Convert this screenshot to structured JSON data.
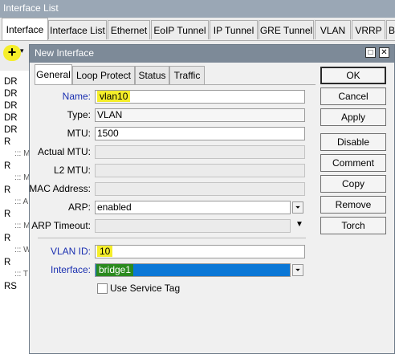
{
  "window": {
    "title": "Interface List"
  },
  "tabs": [
    {
      "label": "Interface",
      "active": true
    },
    {
      "label": "Interface List"
    },
    {
      "label": "Ethernet"
    },
    {
      "label": "EoIP Tunnel"
    },
    {
      "label": "IP Tunnel"
    },
    {
      "label": "GRE Tunnel"
    },
    {
      "label": "VLAN"
    },
    {
      "label": "VRRP"
    },
    {
      "label": "B"
    }
  ],
  "toolbar": {
    "add_icon": "plus-icon",
    "add_glyph": "+",
    "caret": "▾"
  },
  "list_rows": [
    "DR",
    "DR",
    "DR",
    "DR",
    "DR",
    "R",
    "::: M",
    "R",
    "::: M",
    "R",
    "::: A",
    "R",
    "::: M",
    "R",
    "::: W",
    "R",
    "::: T",
    "RS"
  ],
  "dialog": {
    "title": "New Interface",
    "tabs": [
      "General",
      "Loop Protect",
      "Status",
      "Traffic"
    ],
    "fields": {
      "name": {
        "label": "Name:",
        "value": "vlan10"
      },
      "type": {
        "label": "Type:",
        "value": "VLAN"
      },
      "mtu": {
        "label": "MTU:",
        "value": "1500"
      },
      "actual_mtu": {
        "label": "Actual MTU:",
        "value": ""
      },
      "l2_mtu": {
        "label": "L2 MTU:",
        "value": ""
      },
      "mac": {
        "label": "MAC Address:",
        "value": ""
      },
      "arp": {
        "label": "ARP:",
        "value": "enabled"
      },
      "arp_timeout": {
        "label": "ARP Timeout:",
        "value": ""
      },
      "vlan_id": {
        "label": "VLAN ID:",
        "value": "10"
      },
      "interface": {
        "label": "Interface:",
        "value": "bridge1"
      }
    },
    "checkbox": {
      "label": "Use Service Tag",
      "checked": false
    },
    "buttons": {
      "ok": "OK",
      "cancel": "Cancel",
      "apply": "Apply",
      "disable": "Disable",
      "comment": "Comment",
      "copy": "Copy",
      "remove": "Remove",
      "torch": "Torch"
    },
    "controls": {
      "restore_glyph": "□",
      "close_glyph": "✕",
      "dropdown_glyph": "▼",
      "dropdown_small": "⏷"
    }
  },
  "colors": {
    "highlight": "#f5ee2a",
    "selection": "#0a77d6",
    "label_blue": "#1a2fb0",
    "title_bar": "#7d8a98"
  }
}
